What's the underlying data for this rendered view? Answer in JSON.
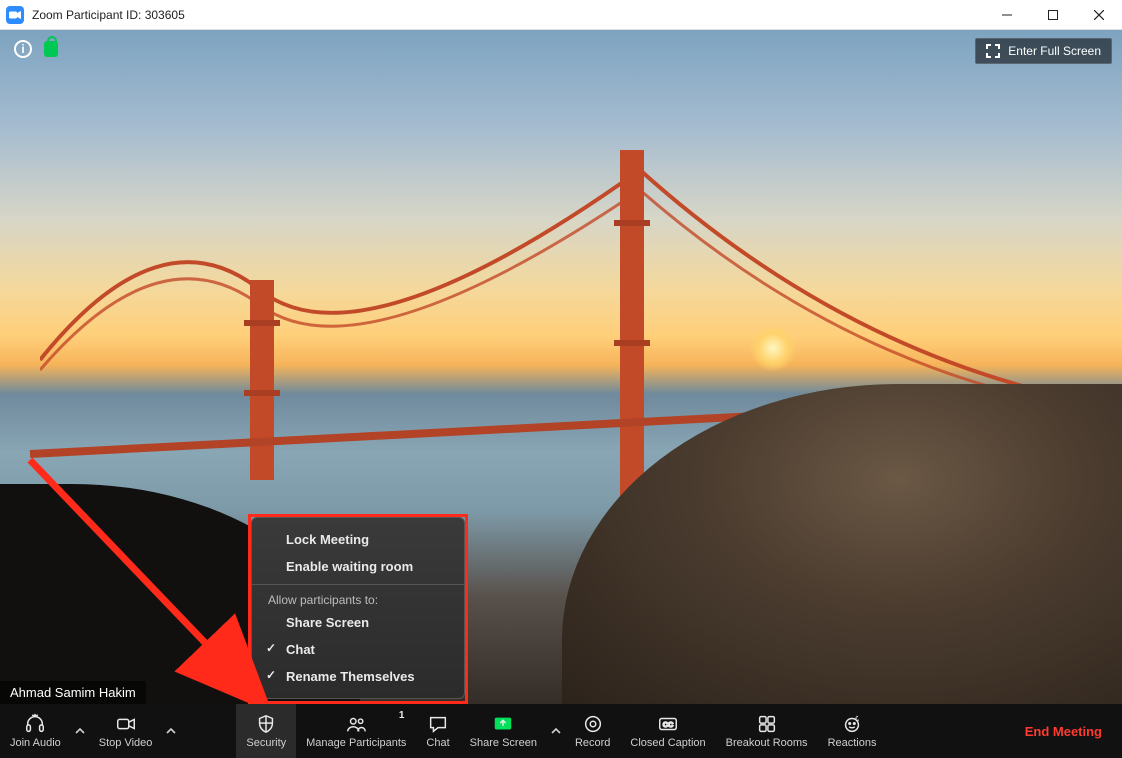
{
  "window": {
    "title": "Zoom Participant ID: 303605"
  },
  "topRight": {
    "fullscreen": "Enter Full Screen"
  },
  "presenter": {
    "name": "Ahmad Samim Hakim"
  },
  "securityMenu": {
    "lock": "Lock Meeting",
    "waiting": "Enable waiting room",
    "sectionLabel": "Allow participants to:",
    "share": "Share Screen",
    "chat": "Chat",
    "rename": "Rename Themselves"
  },
  "toolbar": {
    "joinAudio": "Join Audio",
    "stopVideo": "Stop Video",
    "security": "Security",
    "manageParticipants": "Manage Participants",
    "participantsCount": "1",
    "chat": "Chat",
    "shareScreen": "Share Screen",
    "record": "Record",
    "closedCaption": "Closed Caption",
    "breakoutRooms": "Breakout Rooms",
    "reactions": "Reactions",
    "end": "End Meeting"
  }
}
